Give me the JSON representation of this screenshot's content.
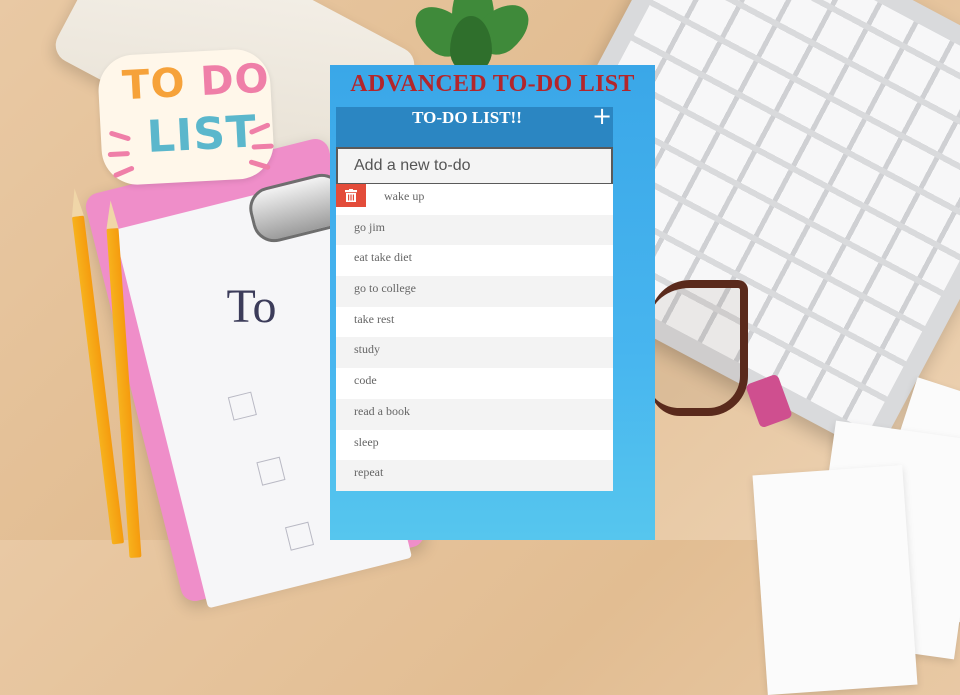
{
  "app": {
    "title": "ADVANCED TO-DO LIST",
    "list_title": "TO-DO LIST!!",
    "add_icon": "plus-icon",
    "input_placeholder": "Add a new to-do",
    "input_value": "",
    "delete_icon": "trash-icon",
    "colors": {
      "title": "#b3262b",
      "header": "#2b86c2",
      "panel": "#47b5ef",
      "delete": "#e34c3a"
    },
    "todos": [
      {
        "text": "wake up"
      },
      {
        "text": "go jim"
      },
      {
        "text": "eat take diet"
      },
      {
        "text": "go to college"
      },
      {
        "text": "take rest"
      },
      {
        "text": "study"
      },
      {
        "text": "code"
      },
      {
        "text": "read a book"
      },
      {
        "text": "sleep"
      },
      {
        "text": "repeat"
      }
    ]
  },
  "background": {
    "sticker_line1": "TO DO",
    "sticker_line2": "LIST",
    "clipboard_text": "To"
  }
}
